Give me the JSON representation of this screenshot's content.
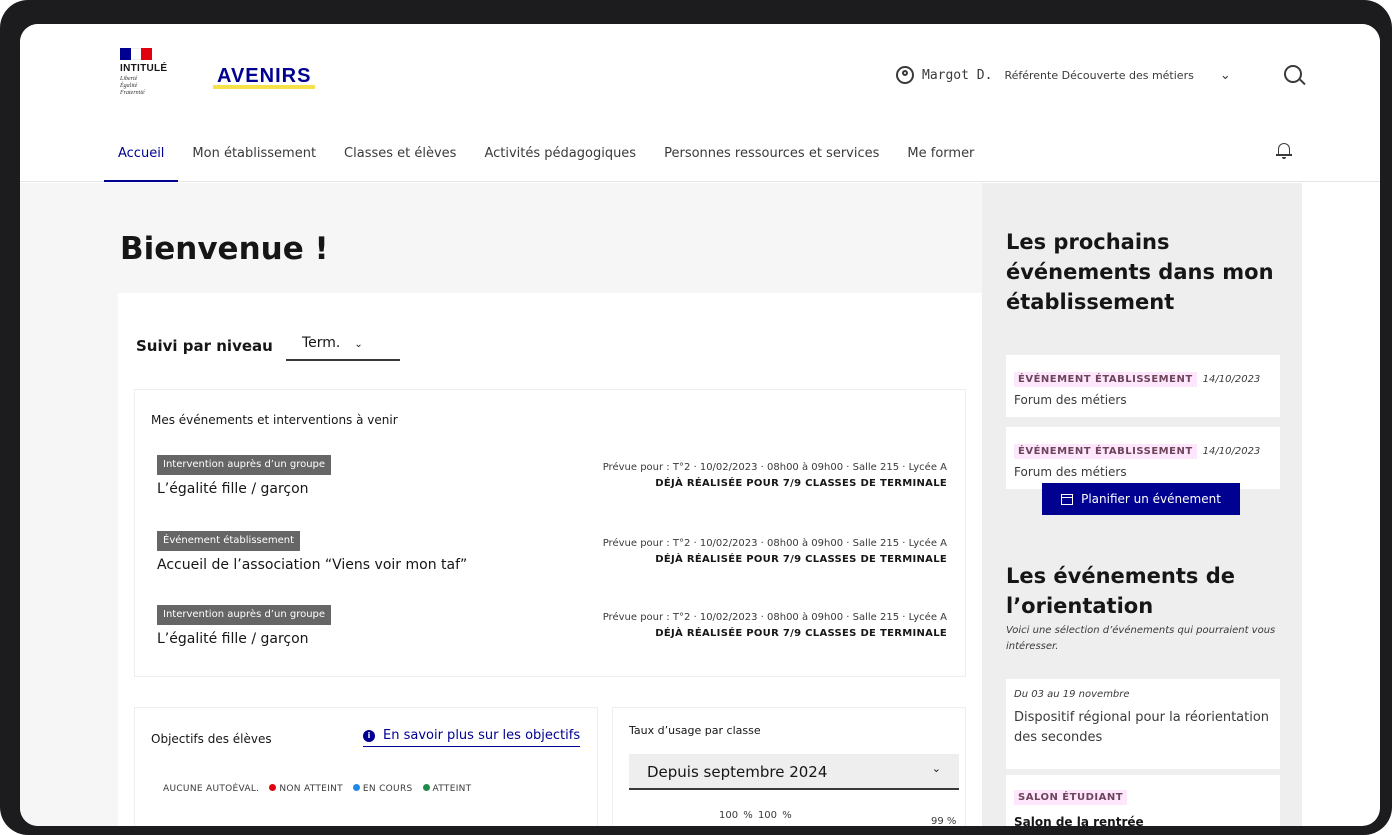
{
  "header": {
    "intitule": "INTITULÉ",
    "motto": [
      "Liberté",
      "Égalité",
      "Fraternité"
    ],
    "logo": "AVENIRS",
    "user_name": "Margot D.",
    "user_role": "Référente Découverte des métiers",
    "chevron": "⌄"
  },
  "nav": {
    "items": [
      "Accueil",
      "Mon établissement",
      "Classes et élèves",
      "Activités pédagogiques",
      "Personnes ressources et services",
      "Me former"
    ],
    "active": "Accueil"
  },
  "main": {
    "title": "Bienvenue !",
    "level_label": "Suivi par niveau",
    "level_value": "Term.",
    "events_title": "Mes événements et interventions à venir",
    "events": [
      {
        "tag": "Intervention auprès d’un groupe",
        "name": "L’égalité fille / garçon",
        "when": "Prévue pour : T°2 · 10/02/2023 · 08h00 à 09h00 · Salle 215 · Lycée A",
        "status": "DÉJÀ RÉALISÉE POUR 7/9 CLASSES DE TERMINALE"
      },
      {
        "tag": "Événement établissement",
        "name": "Accueil de l’association “Viens voir mon taf”",
        "when": "Prévue pour : T°2 · 10/02/2023 · 08h00 à 09h00 · Salle 215 · Lycée A",
        "status": "DÉJÀ RÉALISÉE POUR 7/9 CLASSES DE TERMINALE"
      },
      {
        "tag": "Intervention auprès d’un groupe",
        "name": "L’égalité fille / garçon",
        "when": "Prévue pour : T°2 · 10/02/2023 · 08h00 à 09h00 · Salle 215 · Lycée A",
        "status": "DÉJÀ RÉALISÉE POUR 7/9 CLASSES DE TERMINALE"
      }
    ],
    "objectives_title": "Objectifs des élèves",
    "objectives_link": "En savoir plus sur les objectifs",
    "legend": [
      {
        "label": "AUCUNE AUTOÉVAL.",
        "color": ""
      },
      {
        "label": "NON ATTEINT",
        "color": "#e1000f"
      },
      {
        "label": "EN COURS",
        "color": "#1f8ae6"
      },
      {
        "label": "ATTEINT",
        "color": "#1f8d49"
      }
    ],
    "usage_title": "Taux d’usage par classe",
    "usage_select": "Depuis septembre 2024",
    "usage_values": "100 %  100 %",
    "usage_right": "99 %"
  },
  "sidebar": {
    "title1": "Les prochains événements dans mon établissement",
    "cards": [
      {
        "tag": "ÉVÉNEMENT ÉTABLISSEMENT",
        "date": "14/10/2023",
        "name": "Forum des métiers"
      },
      {
        "tag": "ÉVÉNEMENT ÉTABLISSEMENT",
        "date": "14/10/2023",
        "name": "Forum des métiers"
      }
    ],
    "plan_button": "Planifier un événement",
    "title2": "Les événements de l’orientation",
    "subtitle2": "Voici une sélection d’événements qui pourraient vous intéresser.",
    "orient1_date": "Du 03 au 19 novembre",
    "orient1_name": "Dispositif régional pour la réorientation des secondes",
    "orient2_tag": "SALON ÉTUDIANT",
    "orient2_name": "Salon de la rentrée"
  }
}
